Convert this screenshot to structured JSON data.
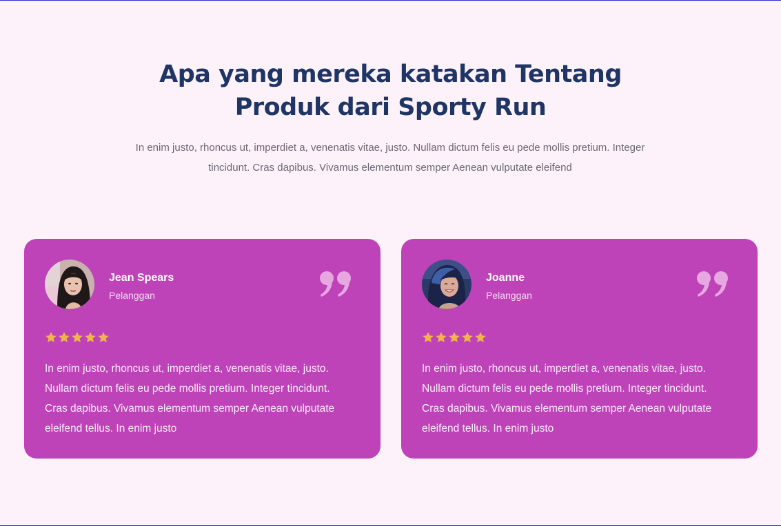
{
  "section": {
    "title_line1": "Apa yang mereka katakan Tentang",
    "title_line2": "Produk dari Sporty Run",
    "intro": "In enim justo, rhoncus ut, imperdiet a, venenatis vitae, justo. Nullam dictum felis eu pede mollis pretium. Integer tincidunt. Cras dapibus. Vivamus elementum semper Aenean vulputate eleifend"
  },
  "testimonials": [
    {
      "name": "Jean Spears",
      "role": "Pelanggan",
      "rating": 5,
      "text": "In enim justo, rhoncus ut, imperdiet a, venenatis vitae, justo. Nullam dictum felis eu pede mollis pretium. Integer tincidunt. Cras dapibus. Vivamus elementum semper Aenean vulputate eleifend tellus. In enim justo",
      "avatar_icon": "woman-portrait-icon"
    },
    {
      "name": "Joanne",
      "role": "Pelanggan",
      "rating": 5,
      "text": "In enim justo, rhoncus ut, imperdiet a, venenatis vitae, justo. Nullam dictum felis eu pede mollis pretium. Integer tincidunt. Cras dapibus. Vivamus elementum semper Aenean vulputate eleifend tellus. In enim justo",
      "avatar_icon": "woman-portrait-icon"
    }
  ],
  "colors": {
    "page_background": "#fdf2fa",
    "heading": "#1f3565",
    "body_text": "#6b6772",
    "card_background": "#bf43b8",
    "star": "#f0b44c",
    "quote_mark": "#e7a8e2"
  },
  "icons": {
    "quote": "quote-mark-icon",
    "star": "star-icon"
  }
}
